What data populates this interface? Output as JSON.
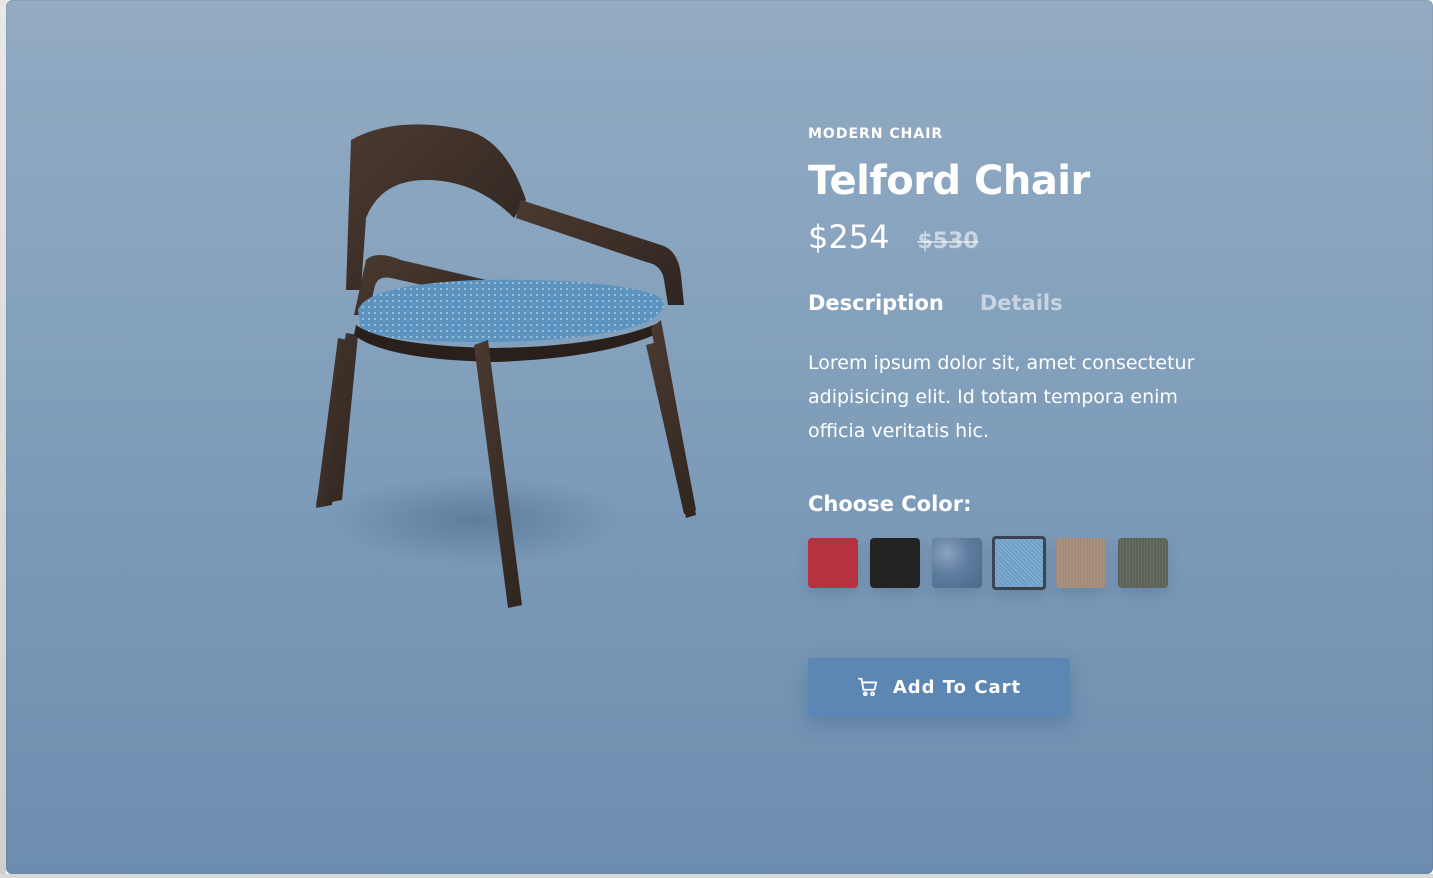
{
  "product": {
    "category": "MODERN CHAIR",
    "name": "Telford Chair",
    "price": "$254",
    "old_price": "$530"
  },
  "tabs": [
    {
      "label": "Description",
      "active": true
    },
    {
      "label": "Details",
      "active": false
    }
  ],
  "description": "Lorem ipsum dolor sit, amet consectetur adipisicing elit. Id totam tempora enim officia veritatis hic.",
  "color_picker": {
    "label": "Choose Color:",
    "swatches": [
      {
        "name": "red",
        "color": "#b8313e",
        "selected": false
      },
      {
        "name": "black",
        "color": "#232323",
        "selected": false
      },
      {
        "name": "denim",
        "color": "#5f7c9e",
        "selected": false
      },
      {
        "name": "light-blue",
        "color": "#6e9dc4",
        "selected": true
      },
      {
        "name": "beige",
        "color": "#a38b78",
        "selected": false
      },
      {
        "name": "gray",
        "color": "#5b6258",
        "selected": false
      }
    ]
  },
  "cart_button": {
    "label": "Add To Cart",
    "icon": "cart-icon"
  },
  "colors": {
    "background_top": "#93abc3",
    "background_bottom": "#6c8daf",
    "button": "#5c86b4",
    "text": "#ffffff"
  }
}
